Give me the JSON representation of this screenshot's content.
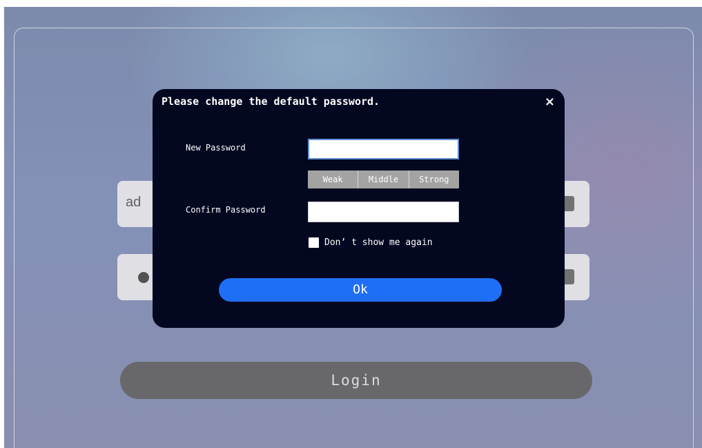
{
  "login": {
    "username_partial": "ad",
    "login_label": "Login"
  },
  "dialog": {
    "title": "Please change the default password.",
    "close_glyph": "×",
    "new_password_label": "New Password",
    "confirm_password_label": "Confirm Password",
    "new_password_value": "",
    "confirm_password_value": "",
    "strength": [
      "Weak",
      "Middle",
      "Strong"
    ],
    "dont_show_label": "Don’ t show me again",
    "dont_show_checked": false,
    "ok_label": "Ok"
  },
  "icons": {
    "user_field": "user-icon",
    "pass_field_left": "dot-icon",
    "pass_field_right": "lock-icon",
    "close": "close-icon"
  },
  "colors": {
    "dialog_bg": "#040720",
    "ok_button": "#1e6ff6",
    "login_button": "#6c6c6e",
    "strength_segment": "#a3a3a3",
    "input_focus_border": "#5d90d6"
  }
}
